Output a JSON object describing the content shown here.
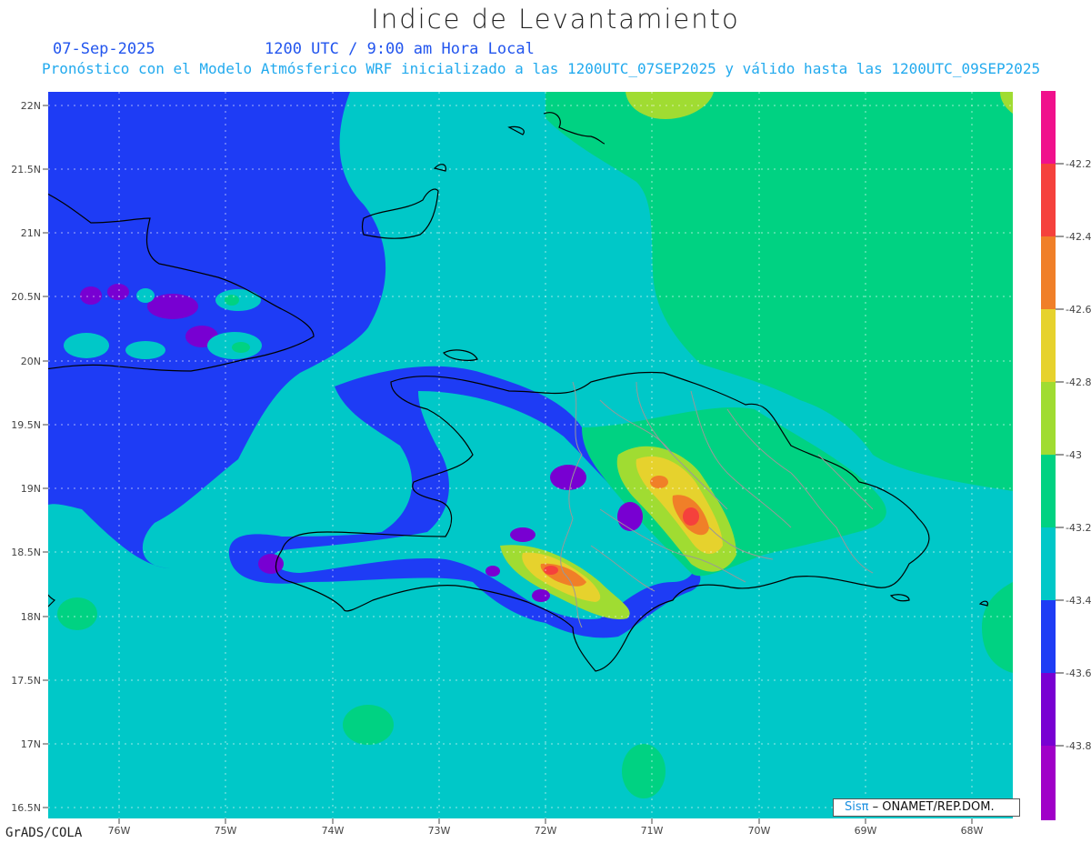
{
  "title": "Indice de Levantamiento",
  "date": "07-Sep-2025",
  "time_label": "1200 UTC / 9:00 am Hora Local",
  "subtitle": "Pronóstico con el Modelo Atmósferico WRF inicializado a las 1200UTC_07SEP2025 y válido hasta las  1200UTC_09SEP2025",
  "footer": "GrADS/COLA",
  "credit": {
    "brand": "Sisπ",
    "org": " – ONAMET/REP.DOM."
  },
  "axes": {
    "lat_labels": [
      "22N",
      "21.5N",
      "21N",
      "20.5N",
      "20N",
      "19.5N",
      "19N",
      "18.5N",
      "18N",
      "17.5N",
      "17N",
      "16.5N"
    ],
    "lon_labels": [
      "76W",
      "75W",
      "74W",
      "73W",
      "72W",
      "71W",
      "70W",
      "69W",
      "68W"
    ]
  },
  "colorbar": {
    "labels": [
      "-42.2",
      "-42.4",
      "-42.6",
      "-42.8",
      "-43",
      "-43.2",
      "-43.4",
      "-43.6",
      "-43.8"
    ],
    "colors": [
      "#f0108c",
      "#f5413c",
      "#f07f28",
      "#e6d22d",
      "#a0dc32",
      "#00d282",
      "#00c8c8",
      "#1e3cf5",
      "#7800d2",
      "#a000c8"
    ]
  }
}
